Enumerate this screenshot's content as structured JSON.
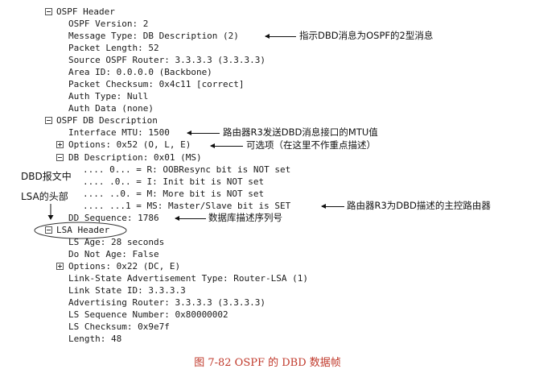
{
  "tree": {
    "ospf_header": {
      "label": "OSPF Header",
      "version": "OSPF Version: 2",
      "message_type": "Message Type: DB Description (2)",
      "packet_length": "Packet Length: 52",
      "source_router": "Source OSPF Router: 3.3.3.3 (3.3.3.3)",
      "area_id": "Area ID: 0.0.0.0 (Backbone)",
      "checksum": "Packet Checksum: 0x4c11 [correct]",
      "auth_type": "Auth Type: Null",
      "auth_data": "Auth Data (none)"
    },
    "db_description": {
      "label": "OSPF DB Description",
      "interface_mtu": "Interface MTU: 1500",
      "options": "Options: 0x52 (O, L, E)",
      "dbd_flags": "DB Description: 0x01 (MS)",
      "flag_r": ".... 0... = R: OOBResync bit is NOT set",
      "flag_i": ".... .0.. = I: Init bit is NOT set",
      "flag_m": ".... ..0. = M: More bit is NOT set",
      "flag_ms": ".... ...1 = MS: Master/Slave bit is SET",
      "dd_sequence": "DD Sequence: 1786"
    },
    "lsa_header": {
      "label": "LSA Header",
      "ls_age": "LS Age: 28 seconds",
      "do_not_age": "Do Not Age: False",
      "options": "Options: 0x22 (DC, E)",
      "ls_type": "Link-State Advertisement Type: Router-LSA (1)",
      "link_state_id": "Link State ID: 3.3.3.3",
      "advertising_router": "Advertising Router: 3.3.3.3 (3.3.3.3)",
      "ls_seq": "LS Sequence Number: 0x80000002",
      "ls_checksum": "LS Checksum: 0x9e7f",
      "length": "Length: 48"
    }
  },
  "annotations": {
    "message_type": "指示DBD消息为OSPF的2型消息",
    "interface_mtu": "路由器R3发送DBD消息接口的MTU值",
    "options": "可选项（在这里不作重点描述）",
    "ms_bit": "路由器R3为DBD描述的主控路由器",
    "dd_sequence": "数据库描述序列号",
    "lsa_side_line1": "DBD报文中",
    "lsa_side_line2": "LSA的头部"
  },
  "caption": "图 7-82   OSPF 的 DBD 数据帧"
}
